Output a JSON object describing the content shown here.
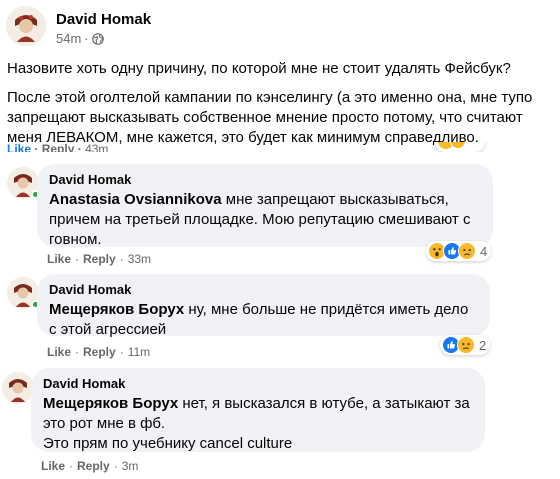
{
  "post": {
    "author": "David Homak",
    "time": "54m",
    "dot": "·",
    "line1": "Назовите хоть одну причину, по которой мне не стоит удалять Фейсбук?",
    "line2": "После этой оголтелой кампании по кэнселингу (а это именно она, мне тупо запрещают высказывать собственное мнение просто потому, что считают меня ЛЕВАКОМ, мне кажется, это будет как минимум справедливо."
  },
  "prev_comment_actions": {
    "like": "Like",
    "reply": "Reply",
    "time": "43m"
  },
  "comments": [
    {
      "author": "David Homak",
      "mention": "Anastasia Ovsiannikova",
      "text": " мне запрещают высказываться, причем на третьей площадке. Мою репутацию смешивают с говном.",
      "like": "Like",
      "reply": "Reply",
      "time": "33m",
      "reactions": [
        "wow",
        "like",
        "sad"
      ],
      "reaction_count": "4"
    },
    {
      "author": "David Homak",
      "mention": "Мещеряков Борух",
      "text": " ну, мне больше не придётся иметь дело с этой агрессией",
      "like": "Like",
      "reply": "Reply",
      "time": "11m",
      "reactions": [
        "like",
        "sad"
      ],
      "reaction_count": "2"
    },
    {
      "author": "David Homak",
      "mention": "Мещеряков Борух",
      "text": " нет, я высказался в ютубе, а затыкают за это рот мне в фб.",
      "text2": "Это прям по учебнику cancel culture",
      "like": "Like",
      "reply": "Reply",
      "time": "3m"
    }
  ],
  "colors": {
    "bubble": "#f0f2f5",
    "secondary_text": "#65676b",
    "like_blue": "#1877f2",
    "online_green": "#31a24c"
  }
}
